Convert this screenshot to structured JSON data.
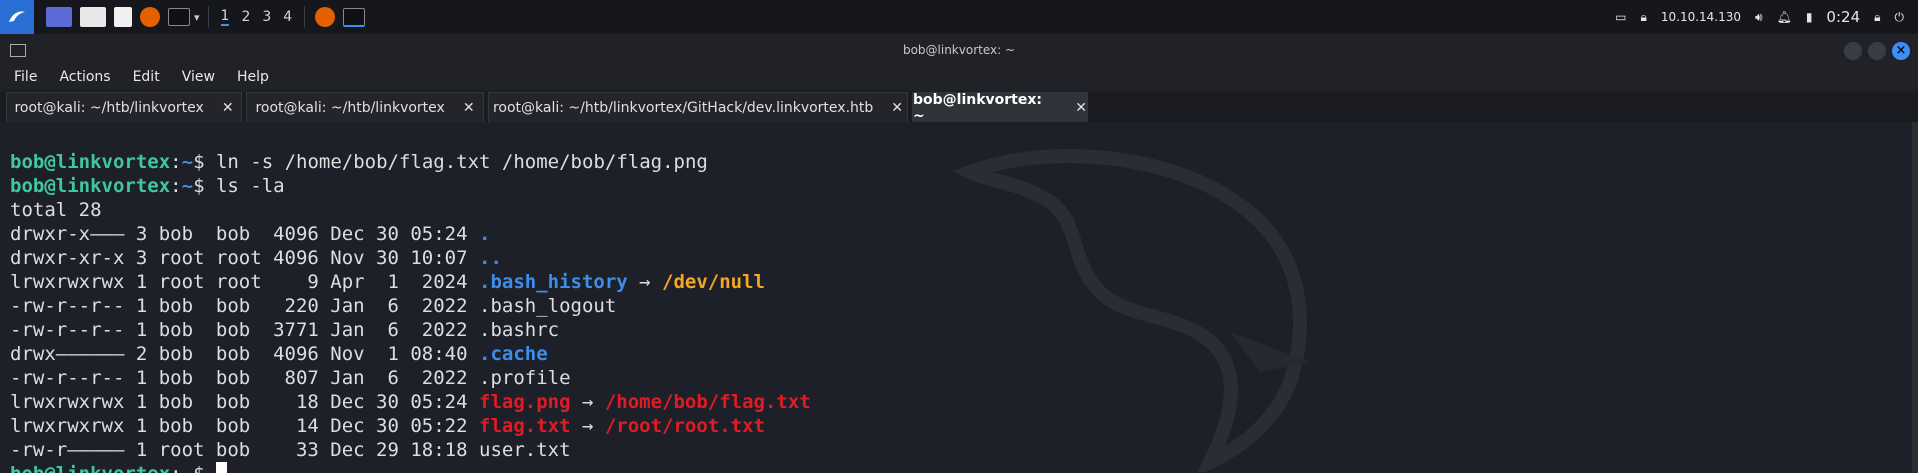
{
  "taskbar": {
    "workspaces": [
      "1",
      "2",
      "3",
      "4"
    ],
    "ip": "10.10.14.130",
    "clock": "0:24"
  },
  "window": {
    "title": "bob@linkvortex: ~"
  },
  "menu": [
    "File",
    "Actions",
    "Edit",
    "View",
    "Help"
  ],
  "tabs": [
    {
      "label": "root@kali: ~/htb/linkvortex",
      "close": "✕"
    },
    {
      "label": "root@kali: ~/htb/linkvortex",
      "close": "✕"
    },
    {
      "label": "root@kali: ~/htb/linkvortex/GitHack/dev.linkvortex.htb",
      "close": "✕"
    },
    {
      "label": "bob@linkvortex: ~",
      "close": "✕"
    }
  ],
  "terminal": {
    "prompt_user": "bob@linkvortex",
    "prompt_sep": ":",
    "prompt_dir": "~",
    "prompt_sym": "$ ",
    "cmd1": "ln -s /home/bob/flag.txt /home/bob/flag.png",
    "cmd2": "ls -la",
    "total": "total 28",
    "rows": [
      {
        "meta": "drwxr-x——— 3 bob  bob  4096 Dec 30 05:24 ",
        "name": ".",
        "cls": "b",
        "arrow": "",
        "target": "",
        "tcls": ""
      },
      {
        "meta": "drwxr-xr-x 3 root root 4096 Nov 30 10:07 ",
        "name": "..",
        "cls": "b",
        "arrow": "",
        "target": "",
        "tcls": ""
      },
      {
        "meta": "lrwxrwxrwx 1 root root    9 Apr  1  2024 ",
        "name": ".bash_history",
        "cls": "b",
        "arrow": " → ",
        "target": "/dev/null",
        "tcls": "o"
      },
      {
        "meta": "-rw-r--r-- 1 bob  bob   220 Jan  6  2022 ",
        "name": ".bash_logout",
        "cls": "w",
        "arrow": "",
        "target": "",
        "tcls": ""
      },
      {
        "meta": "-rw-r--r-- 1 bob  bob  3771 Jan  6  2022 ",
        "name": ".bashrc",
        "cls": "w",
        "arrow": "",
        "target": "",
        "tcls": ""
      },
      {
        "meta": "drwx—————— 2 bob  bob  4096 Nov  1 08:40 ",
        "name": ".cache",
        "cls": "b",
        "arrow": "",
        "target": "",
        "tcls": ""
      },
      {
        "meta": "-rw-r--r-- 1 bob  bob   807 Jan  6  2022 ",
        "name": ".profile",
        "cls": "w",
        "arrow": "",
        "target": "",
        "tcls": ""
      },
      {
        "meta": "lrwxrwxrwx 1 bob  bob    18 Dec 30 05:24 ",
        "name": "flag.png",
        "cls": "r",
        "arrow": " → ",
        "target": "/home/bob/flag.txt",
        "tcls": "r"
      },
      {
        "meta": "lrwxrwxrwx 1 bob  bob    14 Dec 30 05:22 ",
        "name": "flag.txt",
        "cls": "r",
        "arrow": " → ",
        "target": "/root/root.txt",
        "tcls": "r"
      },
      {
        "meta": "-rw-r————— 1 root bob    33 Dec 29 18:18 ",
        "name": "user.txt",
        "cls": "w",
        "arrow": "",
        "target": "",
        "tcls": ""
      }
    ]
  }
}
